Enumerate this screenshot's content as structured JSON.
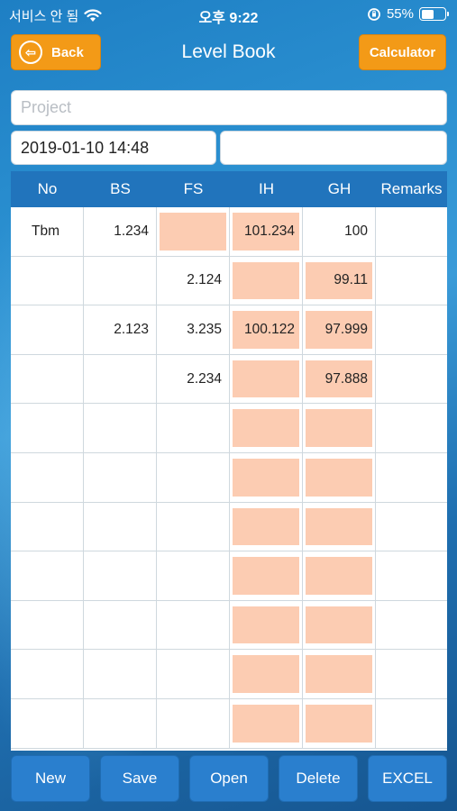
{
  "status_bar": {
    "carrier": "서비스 안 됨",
    "time": "오후 9:22",
    "battery_percent": "55%",
    "battery_level": 0.55
  },
  "nav": {
    "back_label": "Back",
    "title": "Level Book",
    "calculator_label": "Calculator"
  },
  "form": {
    "project_placeholder": "Project",
    "datetime_value": "2019-01-10 14:48",
    "extra_value": ""
  },
  "table": {
    "headers": [
      "No",
      "BS",
      "FS",
      "IH",
      "GH",
      "Remarks"
    ],
    "rows": [
      {
        "no": "Tbm",
        "bs": "1.234",
        "fs": "",
        "ih": "101.234",
        "gh": "100",
        "remarks": ""
      },
      {
        "no": "",
        "bs": "",
        "fs": "2.124",
        "ih": "",
        "gh": "99.11",
        "remarks": ""
      },
      {
        "no": "",
        "bs": "2.123",
        "fs": "3.235",
        "ih": "100.122",
        "gh": "97.999",
        "remarks": ""
      },
      {
        "no": "",
        "bs": "",
        "fs": "2.234",
        "ih": "",
        "gh": "97.888",
        "remarks": ""
      },
      {
        "no": "",
        "bs": "",
        "fs": "",
        "ih": "",
        "gh": "",
        "remarks": ""
      },
      {
        "no": "",
        "bs": "",
        "fs": "",
        "ih": "",
        "gh": "",
        "remarks": ""
      },
      {
        "no": "",
        "bs": "",
        "fs": "",
        "ih": "",
        "gh": "",
        "remarks": ""
      },
      {
        "no": "",
        "bs": "",
        "fs": "",
        "ih": "",
        "gh": "",
        "remarks": ""
      },
      {
        "no": "",
        "bs": "",
        "fs": "",
        "ih": "",
        "gh": "",
        "remarks": ""
      },
      {
        "no": "",
        "bs": "",
        "fs": "",
        "ih": "",
        "gh": "",
        "remarks": ""
      },
      {
        "no": "",
        "bs": "",
        "fs": "",
        "ih": "",
        "gh": "",
        "remarks": ""
      }
    ],
    "highlight_color": "#fcccb2",
    "header_color": "#2174bc"
  },
  "toolbar": {
    "new_label": "New",
    "save_label": "Save",
    "open_label": "Open",
    "delete_label": "Delete",
    "excel_label": "EXCEL"
  },
  "colors": {
    "accent_orange": "#f39a17",
    "button_blue": "#2a7fce"
  }
}
